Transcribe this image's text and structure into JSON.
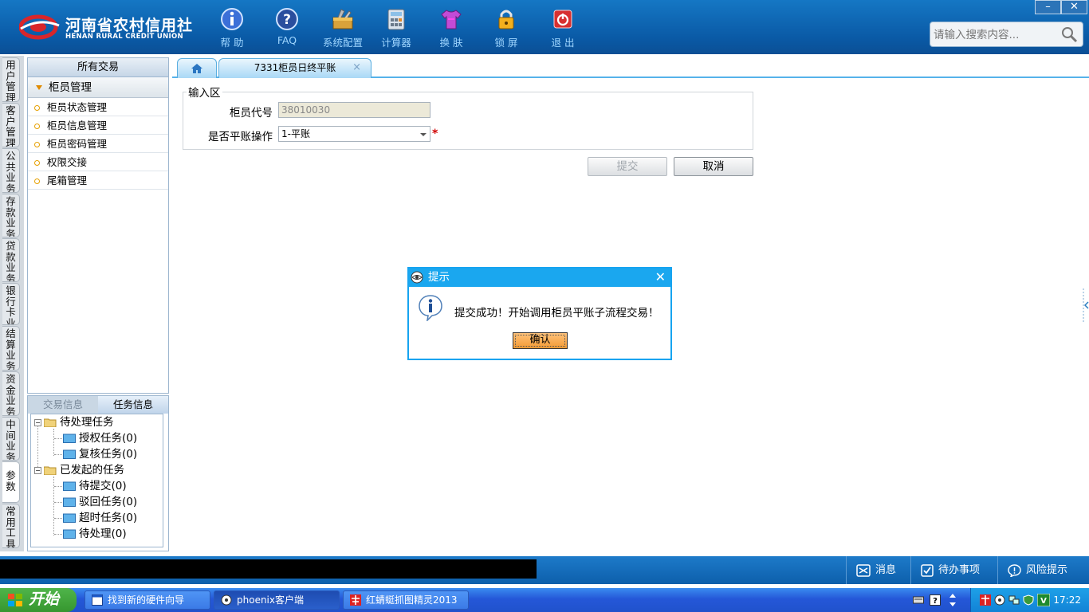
{
  "header": {
    "brand_cn": "河南省农村信用社",
    "brand_en": "HENAN RURAL CREDIT UNION",
    "toolbar": [
      {
        "label": "帮 助",
        "icon": "info-icon"
      },
      {
        "label": "FAQ",
        "icon": "question-icon"
      },
      {
        "label": "系统配置",
        "icon": "toolbox-icon"
      },
      {
        "label": "计算器",
        "icon": "calculator-icon"
      },
      {
        "label": "换 肤",
        "icon": "shirt-icon"
      },
      {
        "label": "锁 屏",
        "icon": "lock-icon"
      },
      {
        "label": "退 出",
        "icon": "power-icon"
      }
    ],
    "window_minimize": "–",
    "window_close": "✕",
    "search_placeholder": "请输入搜索内容..."
  },
  "side_tabs": [
    "用户管理",
    "客户管理",
    "公共业务",
    "存款业务",
    "贷款业务",
    "银行卡业务",
    "结算业务",
    "资金业务",
    "中间业务",
    "参数",
    "常用工具"
  ],
  "left_panel": {
    "title": "所有交易",
    "category": "柜员管理",
    "items": [
      "柜员状态管理",
      "柜员信息管理",
      "柜员密码管理",
      "权限交接",
      "尾箱管理"
    ]
  },
  "task_panel": {
    "tab_trade": "交易信息",
    "tab_task": "任务信息",
    "tree": [
      {
        "label": "待处理任务",
        "children": [
          "授权任务(0)",
          "复核任务(0)"
        ]
      },
      {
        "label": "已发起的任务",
        "children": [
          "待提交(0)",
          "驳回任务(0)",
          "超时任务(0)",
          "待处理(0)"
        ]
      }
    ]
  },
  "tabs": {
    "active_tab": "7331柜员日终平账",
    "tab_close": "×"
  },
  "form": {
    "legend": "输入区",
    "teller_label": "柜员代号",
    "teller_value": "38010030",
    "balance_label": "是否平账操作",
    "balance_value": "1-平账",
    "required_mark": "*",
    "submit_label": "提交",
    "cancel_label": "取消"
  },
  "dialog": {
    "title": "提示",
    "message": "提交成功！开始调用柜员平账子流程交易！",
    "ok_label": "确认",
    "close": "✕"
  },
  "status_bar": {
    "messages": "消息",
    "todo": "待办事项",
    "risk": "风险提示"
  },
  "taskbar": {
    "start": "开始",
    "windows": [
      "找到新的硬件向导",
      "phoenix客户端",
      "红蜻蜓抓图精灵2013"
    ],
    "clock": "17:22"
  },
  "colors": {
    "header_blue": "#0a5aa6",
    "accent_sky": "#1aa7ef",
    "ok_orange": "#f39b34",
    "required_red": "#d00000"
  }
}
